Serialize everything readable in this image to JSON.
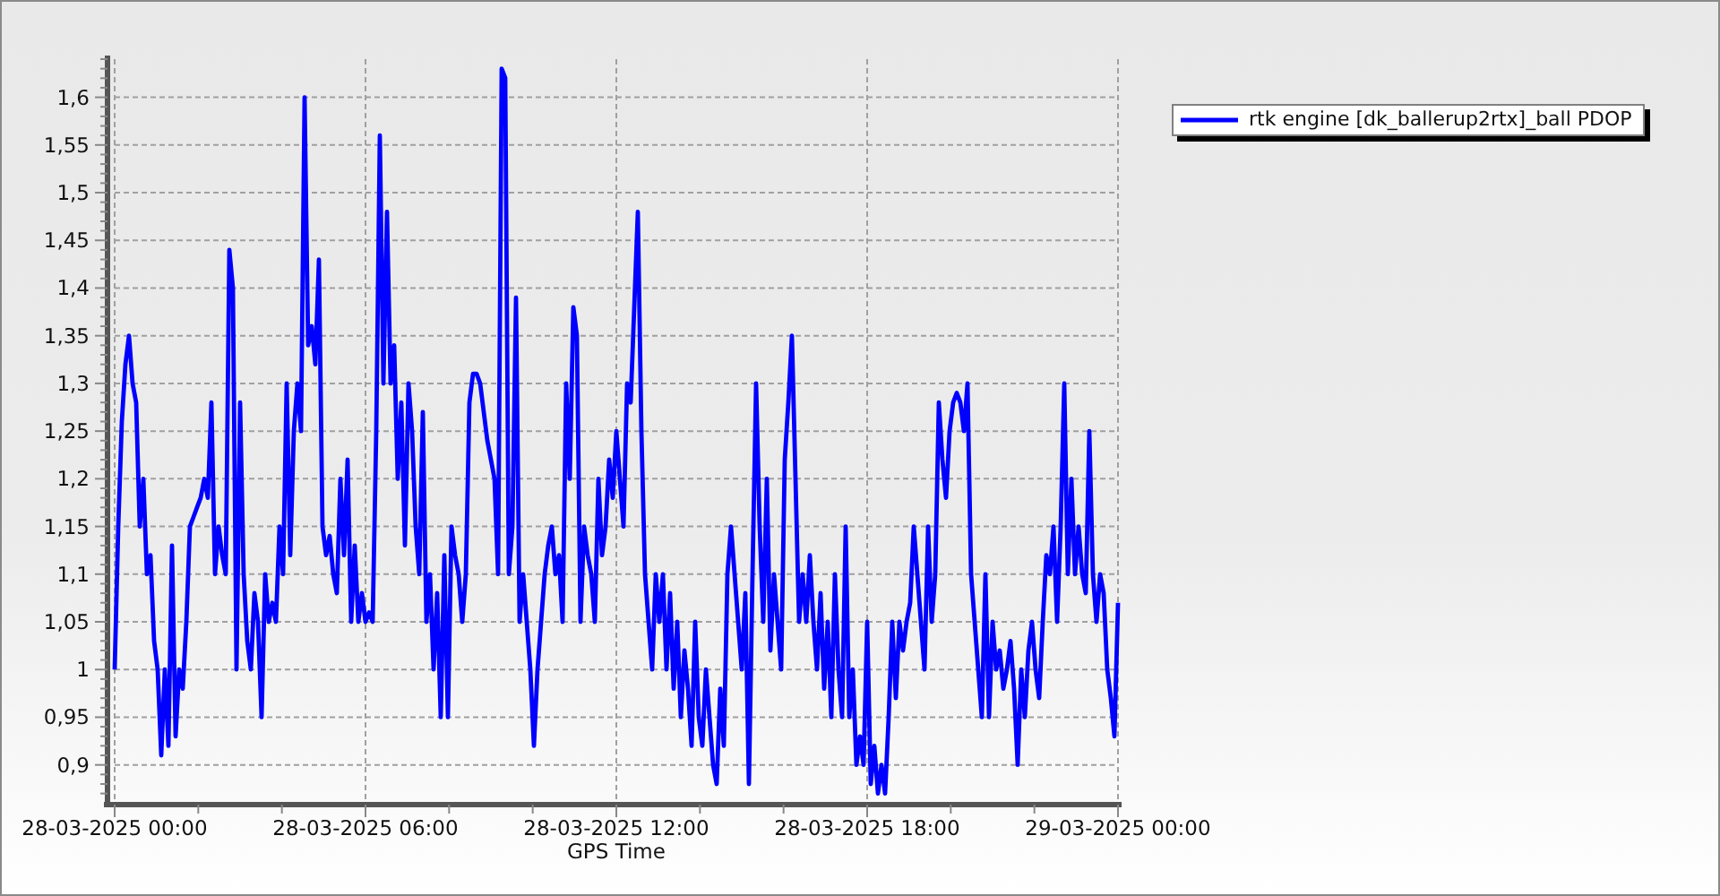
{
  "chart": {
    "chart_data": {
      "type": "line",
      "xlabel": "GPS Time",
      "grid": true,
      "ylim": [
        0.864,
        1.64
      ],
      "categories": [
        "28-03-2025 00:00",
        null,
        null,
        null,
        null,
        null,
        null,
        null,
        null,
        null,
        null,
        null,
        null,
        null,
        null,
        null,
        null,
        null,
        null,
        null,
        null,
        null,
        null,
        null,
        null,
        null,
        null,
        null,
        null,
        null,
        null,
        null,
        null,
        null,
        null,
        null,
        null,
        null,
        null,
        null,
        null,
        null,
        null,
        null,
        null,
        null,
        null,
        null,
        null,
        null,
        null,
        null,
        null,
        null,
        null,
        null,
        null,
        null,
        null,
        null,
        null,
        null,
        null,
        null,
        null,
        null,
        null,
        null,
        null,
        null,
        "28-03-2025 06:00",
        null,
        null,
        null,
        null,
        null,
        null,
        null,
        null,
        null,
        null,
        null,
        null,
        null,
        null,
        null,
        null,
        null,
        null,
        null,
        null,
        null,
        null,
        null,
        null,
        null,
        null,
        null,
        null,
        null,
        null,
        null,
        null,
        null,
        null,
        null,
        null,
        null,
        null,
        null,
        null,
        null,
        null,
        null,
        null,
        null,
        null,
        null,
        null,
        null,
        null,
        null,
        null,
        null,
        null,
        null,
        null,
        null,
        null,
        null,
        null,
        null,
        null,
        null,
        null,
        null,
        null,
        null,
        null,
        null,
        "28-03-2025 12:00",
        null,
        null,
        null,
        null,
        null,
        null,
        null,
        null,
        null,
        null,
        null,
        null,
        null,
        null,
        null,
        null,
        null,
        null,
        null,
        null,
        null,
        null,
        null,
        null,
        null,
        null,
        null,
        null,
        null,
        null,
        null,
        null,
        null,
        null,
        null,
        null,
        null,
        null,
        null,
        null,
        null,
        null,
        null,
        null,
        null,
        null,
        null,
        null,
        null,
        null,
        null,
        null,
        null,
        null,
        null,
        null,
        null,
        null,
        null,
        null,
        null,
        null,
        null,
        null,
        null,
        null,
        null,
        null,
        null,
        "28-03-2025 18:00",
        null,
        null,
        null,
        null,
        null,
        null,
        null,
        null,
        null,
        null,
        null,
        null,
        null,
        null,
        null,
        null,
        null,
        null,
        null,
        null,
        null,
        null,
        null,
        null,
        null,
        null,
        null,
        null,
        null,
        null,
        null,
        null,
        null,
        null,
        null,
        null,
        null,
        null,
        null,
        null,
        null,
        null,
        null,
        null,
        null,
        null,
        null,
        null,
        null,
        null,
        null,
        null,
        null,
        null,
        null,
        null,
        null,
        null,
        null,
        null,
        null,
        null,
        null,
        null,
        null,
        null,
        null,
        null,
        null,
        "29-03-2025 00:00"
      ],
      "yticks": [
        {
          "value": 0.9,
          "label": "0,9"
        },
        {
          "value": 0.95,
          "label": "0,95"
        },
        {
          "value": 1,
          "label": "1"
        },
        {
          "value": 1.05,
          "label": "1,05"
        },
        {
          "value": 1.1,
          "label": "1,1"
        },
        {
          "value": 1.15,
          "label": "1,15"
        },
        {
          "value": 1.2,
          "label": "1,2"
        },
        {
          "value": 1.25,
          "label": "1,25"
        },
        {
          "value": 1.3,
          "label": "1,3"
        },
        {
          "value": 1.35,
          "label": "1,35"
        },
        {
          "value": 1.4,
          "label": "1,4"
        },
        {
          "value": 1.45,
          "label": "1,45"
        },
        {
          "value": 1.5,
          "label": "1,5"
        },
        {
          "value": 1.55,
          "label": "1,55"
        },
        {
          "value": 1.6,
          "label": "1,6"
        }
      ],
      "series": [
        {
          "name": "rtk engine [dk_ballerup2rtx]_ball PDOP",
          "color": "#0000ff",
          "values": [
            1.0,
            1.15,
            1.26,
            1.32,
            1.35,
            1.3,
            1.28,
            1.15,
            1.2,
            1.1,
            1.12,
            1.03,
            1.0,
            0.91,
            1.0,
            0.92,
            1.13,
            0.93,
            1.0,
            0.98,
            1.05,
            1.15,
            1.16,
            1.17,
            1.18,
            1.2,
            1.18,
            1.28,
            1.1,
            1.15,
            1.12,
            1.1,
            1.44,
            1.4,
            1.0,
            1.28,
            1.1,
            1.03,
            1.0,
            1.08,
            1.05,
            0.95,
            1.1,
            1.05,
            1.07,
            1.05,
            1.15,
            1.1,
            1.3,
            1.12,
            1.25,
            1.3,
            1.25,
            1.6,
            1.34,
            1.36,
            1.32,
            1.43,
            1.15,
            1.12,
            1.14,
            1.1,
            1.08,
            1.2,
            1.12,
            1.22,
            1.05,
            1.13,
            1.05,
            1.08,
            1.05,
            1.06,
            1.05,
            1.25,
            1.56,
            1.3,
            1.48,
            1.3,
            1.34,
            1.2,
            1.28,
            1.13,
            1.3,
            1.25,
            1.15,
            1.1,
            1.27,
            1.05,
            1.1,
            1.0,
            1.08,
            0.95,
            1.12,
            0.95,
            1.15,
            1.12,
            1.1,
            1.05,
            1.1,
            1.28,
            1.31,
            1.31,
            1.3,
            1.27,
            1.24,
            1.22,
            1.2,
            1.1,
            1.63,
            1.62,
            1.1,
            1.15,
            1.39,
            1.05,
            1.1,
            1.05,
            1.0,
            0.92,
            1.0,
            1.05,
            1.1,
            1.13,
            1.15,
            1.1,
            1.12,
            1.05,
            1.3,
            1.2,
            1.38,
            1.35,
            1.05,
            1.15,
            1.12,
            1.1,
            1.05,
            1.2,
            1.12,
            1.15,
            1.22,
            1.18,
            1.25,
            1.2,
            1.15,
            1.3,
            1.28,
            1.38,
            1.48,
            1.25,
            1.1,
            1.05,
            1.0,
            1.1,
            1.05,
            1.1,
            1.0,
            1.08,
            0.98,
            1.05,
            0.95,
            1.02,
            0.98,
            0.92,
            1.05,
            0.95,
            0.92,
            1.0,
            0.95,
            0.9,
            0.88,
            0.98,
            0.92,
            1.1,
            1.15,
            1.1,
            1.05,
            1.0,
            1.08,
            0.88,
            1.1,
            1.3,
            1.15,
            1.05,
            1.2,
            1.02,
            1.1,
            1.05,
            1.0,
            1.22,
            1.28,
            1.35,
            1.2,
            1.05,
            1.1,
            1.05,
            1.12,
            1.05,
            1.0,
            1.08,
            0.98,
            1.05,
            0.95,
            1.1,
            1.0,
            0.95,
            1.15,
            0.95,
            1.0,
            0.9,
            0.93,
            0.9,
            1.05,
            0.88,
            0.92,
            0.87,
            0.9,
            0.87,
            0.95,
            1.05,
            0.97,
            1.05,
            1.02,
            1.05,
            1.07,
            1.15,
            1.1,
            1.05,
            1.0,
            1.15,
            1.05,
            1.1,
            1.28,
            1.22,
            1.18,
            1.25,
            1.28,
            1.29,
            1.28,
            1.25,
            1.3,
            1.1,
            1.05,
            1.0,
            0.95,
            1.1,
            0.95,
            1.05,
            1.0,
            1.02,
            0.98,
            1.0,
            1.03,
            0.98,
            0.9,
            1.0,
            0.95,
            1.02,
            1.05,
            1.0,
            0.97,
            1.05,
            1.12,
            1.1,
            1.15,
            1.05,
            1.15,
            1.3,
            1.1,
            1.2,
            1.1,
            1.15,
            1.1,
            1.08,
            1.25,
            1.1,
            1.05,
            1.1,
            1.08,
            1.0,
            0.97,
            0.93,
            1.07
          ]
        }
      ]
    }
  }
}
